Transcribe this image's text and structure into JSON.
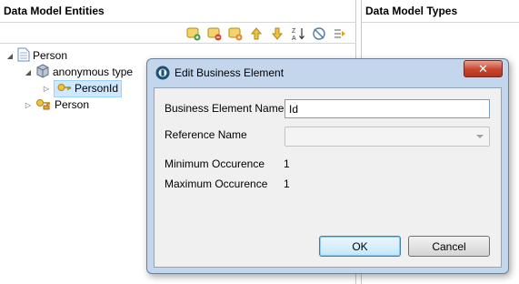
{
  "left_panel": {
    "title": "Data Model Entities",
    "toolbar_icons": [
      "add-element-icon",
      "add-attribute-icon",
      "add-type-icon",
      "move-up-icon",
      "move-down-icon",
      "sort-az-icon",
      "hide-icon",
      "expand-icon"
    ],
    "tree": [
      {
        "label": "Person",
        "icon": "document-icon",
        "expanded": true
      },
      {
        "label": "anonymous type",
        "icon": "cube-icon",
        "expanded": true
      },
      {
        "label": "PersonId",
        "icon": "key-icon",
        "expanded": false,
        "selected": true
      },
      {
        "label": "Person",
        "icon": "key-folder-icon",
        "expanded": false
      }
    ]
  },
  "right_panel": {
    "title": "Data Model Types"
  },
  "dialog": {
    "title": "Edit Business Element",
    "close_label": "✕",
    "fields": {
      "name_label": "Business Element Name",
      "name_value": "Id",
      "reference_label": "Reference Name",
      "reference_value": "",
      "min_label": "Minimum Occurence",
      "min_value": "1",
      "max_label": "Maximum Occurence",
      "max_value": "1"
    },
    "ok_label": "OK",
    "cancel_label": "Cancel"
  }
}
